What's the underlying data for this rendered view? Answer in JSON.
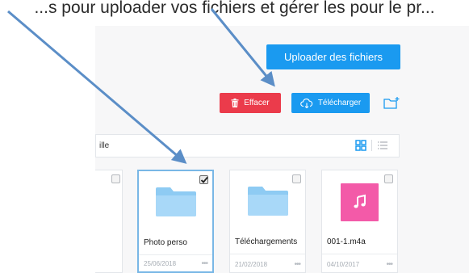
{
  "header_text": "...s pour uploader vos fichiers et gérer les pour le pr...",
  "actions": {
    "upload_label": "Uploader des fichiers",
    "delete_label": "Effacer",
    "download_label": "Télécharger"
  },
  "toolbar": {
    "filter_text": "ille"
  },
  "files": [
    {
      "name": "Photo perso",
      "date": "25/06/2018",
      "type": "folder",
      "selected": true
    },
    {
      "name": "Téléchargements",
      "date": "21/02/2018",
      "type": "folder",
      "selected": false
    },
    {
      "name": "001-1.m4a",
      "date": "04/10/2017",
      "type": "audio",
      "selected": false
    }
  ],
  "more_label": "•••",
  "colors": {
    "accent_blue": "#1a9af0",
    "delete_red": "#eb3b4b",
    "folder_blue": "#a8d8f8",
    "audio_pink": "#f35aa8",
    "arrow_blue": "#5b8ec7"
  },
  "icons": {
    "delete": "trash-icon",
    "download": "cloud-download-icon",
    "new_folder": "new-folder-icon",
    "grid_view": "grid-view-icon",
    "list_view": "list-view-icon",
    "audio": "music-note-icon",
    "folder": "folder-icon",
    "checkbox": "checkmark-icon"
  }
}
